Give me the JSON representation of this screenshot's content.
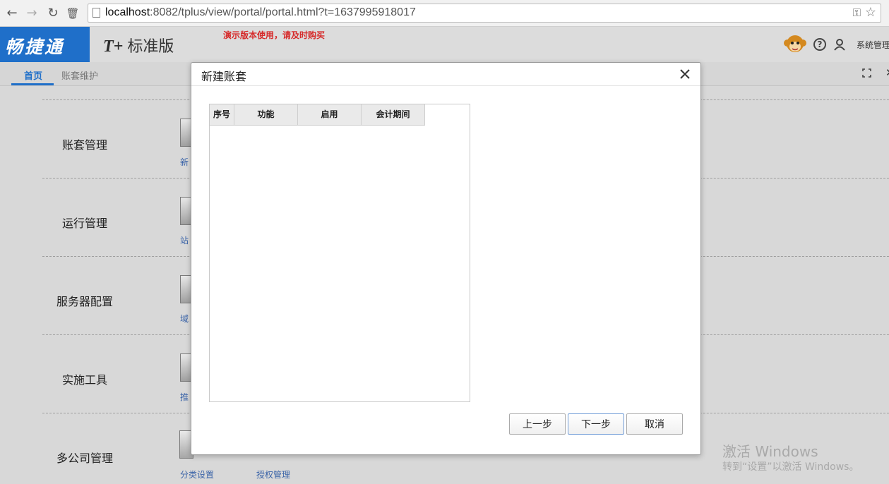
{
  "browser": {
    "url_host": "localhost",
    "url_rest": ":8082/tplus/view/portal/portal.html?t=1637995918017",
    "icons": [
      "back-arrow-icon",
      "forward-arrow-icon",
      "reload-icon",
      "trash-icon",
      "page-icon",
      "key-icon",
      "star-icon"
    ]
  },
  "header": {
    "logo": "畅捷通",
    "product_prefix": "T+",
    "product_name": "标准版",
    "demo_notice": "演示版本使用，请及时购买",
    "system_management": "系统管理"
  },
  "tabs": [
    {
      "label": "首页",
      "active": true
    },
    {
      "label": "账套维护",
      "active": false
    }
  ],
  "sections": [
    {
      "label": "账套管理",
      "sub": "新"
    },
    {
      "label": "运行管理",
      "sub": "站"
    },
    {
      "label": "服务器配置",
      "sub": "域"
    },
    {
      "label": "实施工具",
      "sub": "推"
    },
    {
      "label": "多公司管理",
      "sub": "分类设置"
    }
  ],
  "extra_link": "授权管理",
  "dialog": {
    "title": "新建账套",
    "columns": [
      "序号",
      "功能",
      "启用",
      "会计期间"
    ],
    "rows": [],
    "buttons": {
      "prev": "上一步",
      "next": "下一步",
      "cancel": "取消"
    }
  },
  "watermark": {
    "title": "激活 Windows",
    "subtitle": "转到“设置”以激活 Windows。"
  },
  "colors": {
    "brand_blue": "#1f6fc9",
    "notice_red": "#d62b2b"
  }
}
